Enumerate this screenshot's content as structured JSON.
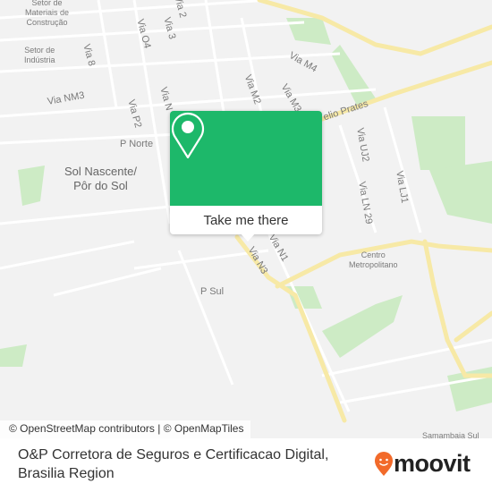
{
  "map": {
    "labels": {
      "setor_materiais": "Setor de\nMateriais de\nConstrução",
      "setor_industria": "Setor de\nIndústria",
      "via8": "Via 8",
      "via_o4": "Via O4",
      "via3": "Via 3",
      "via2": "Via 2",
      "via_nm3": "Via NM3",
      "via_p2": "Via P2",
      "via_n": "Via N",
      "via_m2": "Via M2",
      "via_m3": "Via M3",
      "via_m4": "Via M4",
      "helio_prates": "elio Prates",
      "p_norte": "P Norte",
      "sol_nascente": "Sol Nascente/\nPôr do Sol",
      "via_uj2": "Via UJ2",
      "via_lj1": "Via LJ1",
      "via_ln29": "Via LN 29",
      "via_n1": "Via N1",
      "via_n3": "Via N3",
      "centro": "Centro\nMetropolitano",
      "p_sul": "P Sul",
      "samambaia_sul": "Samambaia Sul"
    },
    "attribution": "© OpenStreetMap contributors | © OpenMapTiles",
    "colors": {
      "background": "#f2f2f2",
      "road": "#ffffff",
      "main_road": "#f7e9a6",
      "park": "#cdebc5"
    }
  },
  "popup": {
    "icon": "map-pin-icon",
    "button_label": "Take me there",
    "color": "#1db86a"
  },
  "footer": {
    "place_name": "O&P Corretora de Seguros e Certificacao Digital,",
    "region": "Brasilia Region",
    "logo_text": "moovit",
    "logo_color": "#f26a2a"
  }
}
